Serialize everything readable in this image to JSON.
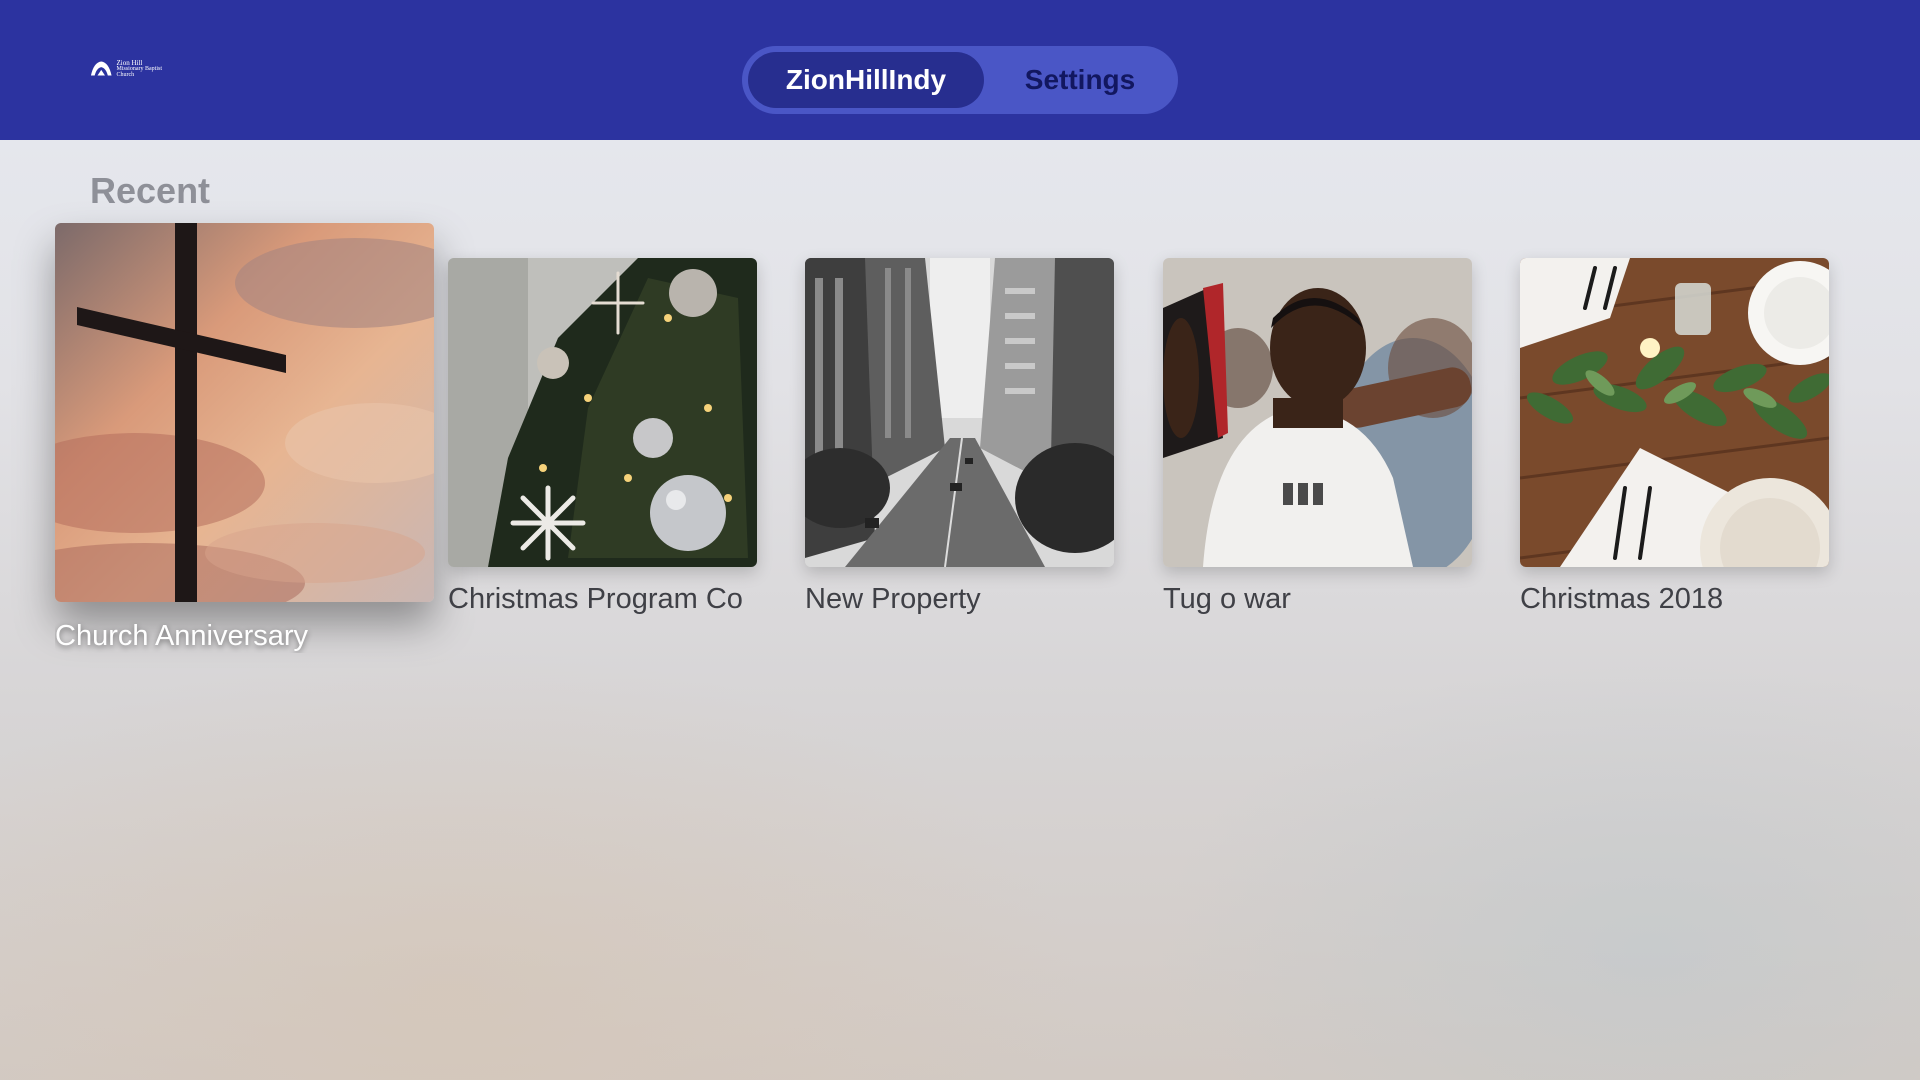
{
  "header": {
    "logo": {
      "icon": "church-logo-icon",
      "line1": "Zion Hill",
      "line2": "Missionary Baptist",
      "line3": "Church"
    },
    "tabs": [
      {
        "label": "ZionHillIndy",
        "selected": true
      },
      {
        "label": "Settings",
        "selected": false
      }
    ],
    "bar_color": "#2c33a0"
  },
  "recent": {
    "title": "Recent",
    "items": [
      {
        "title": "Church Anniversary",
        "thumbnail": "cross-sunset-image",
        "focused": true
      },
      {
        "title": "Christmas Program Co",
        "thumbnail": "christmas-tree-image",
        "focused": false
      },
      {
        "title": "New Property",
        "thumbnail": "city-street-image",
        "focused": false
      },
      {
        "title": "Tug o war",
        "thumbnail": "worship-bible-image",
        "focused": false
      },
      {
        "title": "Christmas 2018",
        "thumbnail": "dinner-table-image",
        "focused": false
      }
    ]
  }
}
